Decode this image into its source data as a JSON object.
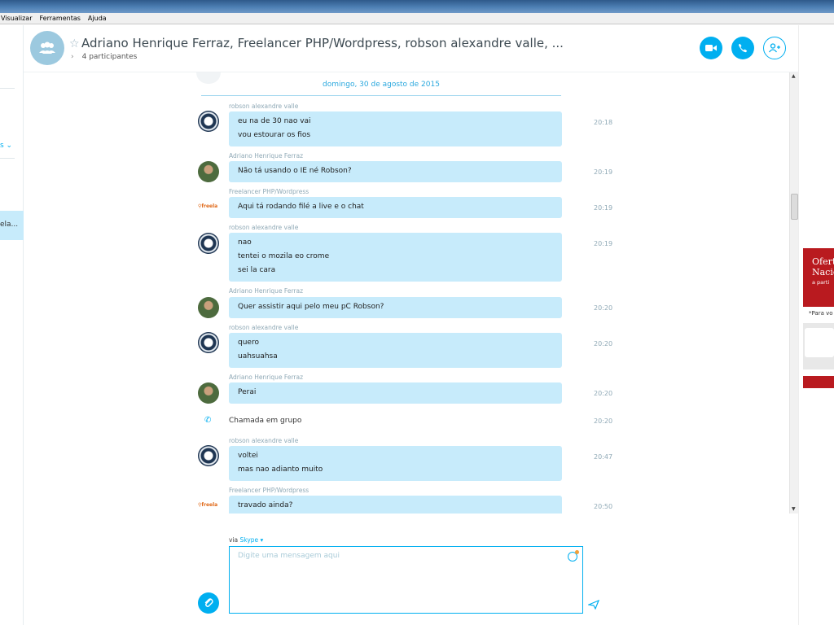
{
  "menubar": [
    "Visualizar",
    "Ferramentas",
    "Ajuda"
  ],
  "sidebar": {
    "selected_fragment": "ela..."
  },
  "header": {
    "title": "Adriano Henrique Ferraz, Freelancer PHP/Wordpress, robson alexandre valle, ...",
    "participants": "4 participantes",
    "video_icon": "video-camera-icon",
    "call_icon": "phone-icon",
    "add_icon": "add-person-icon"
  },
  "date_divider": "domingo, 30 de agosto de 2015",
  "messages": [
    {
      "sender": "robson alexandre valle",
      "lines": [
        "eu na de 30 nao vai",
        "vou estourar os fios"
      ],
      "time": "20:18"
    },
    {
      "sender": "Adriano Henrique Ferraz",
      "lines": [
        "Não tá usando o IE né Robson?"
      ],
      "time": "20:19"
    },
    {
      "sender": "Freelancer PHP/Wordpress",
      "lines": [
        "Aqui tá rodando filé a live e o chat"
      ],
      "time": "20:19"
    },
    {
      "sender": "robson alexandre valle",
      "lines": [
        "nao",
        "tentei o mozila eo crome",
        "sei la cara"
      ],
      "time": "20:19"
    },
    {
      "sender": "Adriano Henrique Ferraz",
      "lines": [
        "Quer assistir aqui pelo meu pC Robson?"
      ],
      "time": "20:20"
    },
    {
      "sender": "robson alexandre valle",
      "lines": [
        "quero",
        "uahsuahsa"
      ],
      "time": "20:20"
    },
    {
      "sender": "Adriano Henrique Ferraz",
      "lines": [
        "Perai"
      ],
      "time": "20:20"
    },
    {
      "sender": "robson alexandre valle",
      "lines": [
        "voltei",
        "mas nao adianto muito"
      ],
      "time": "20:47"
    },
    {
      "sender": "Freelancer PHP/Wordpress",
      "lines": [
        "travado ainda?"
      ],
      "time": "20:50"
    }
  ],
  "call_event": {
    "text": "Chamada em grupo",
    "time": "20:20"
  },
  "compose": {
    "via_label": "via",
    "via_service": "Skype",
    "placeholder": "Digite uma mensagem aqui"
  },
  "ad": {
    "headline_1": "Ofert",
    "headline_2": "Nacio",
    "sub": "a parti",
    "note": "*Para vo"
  },
  "colors": {
    "accent": "#00aff0",
    "bubble": "#c7ebfb",
    "ad_red": "#b91a1f"
  }
}
